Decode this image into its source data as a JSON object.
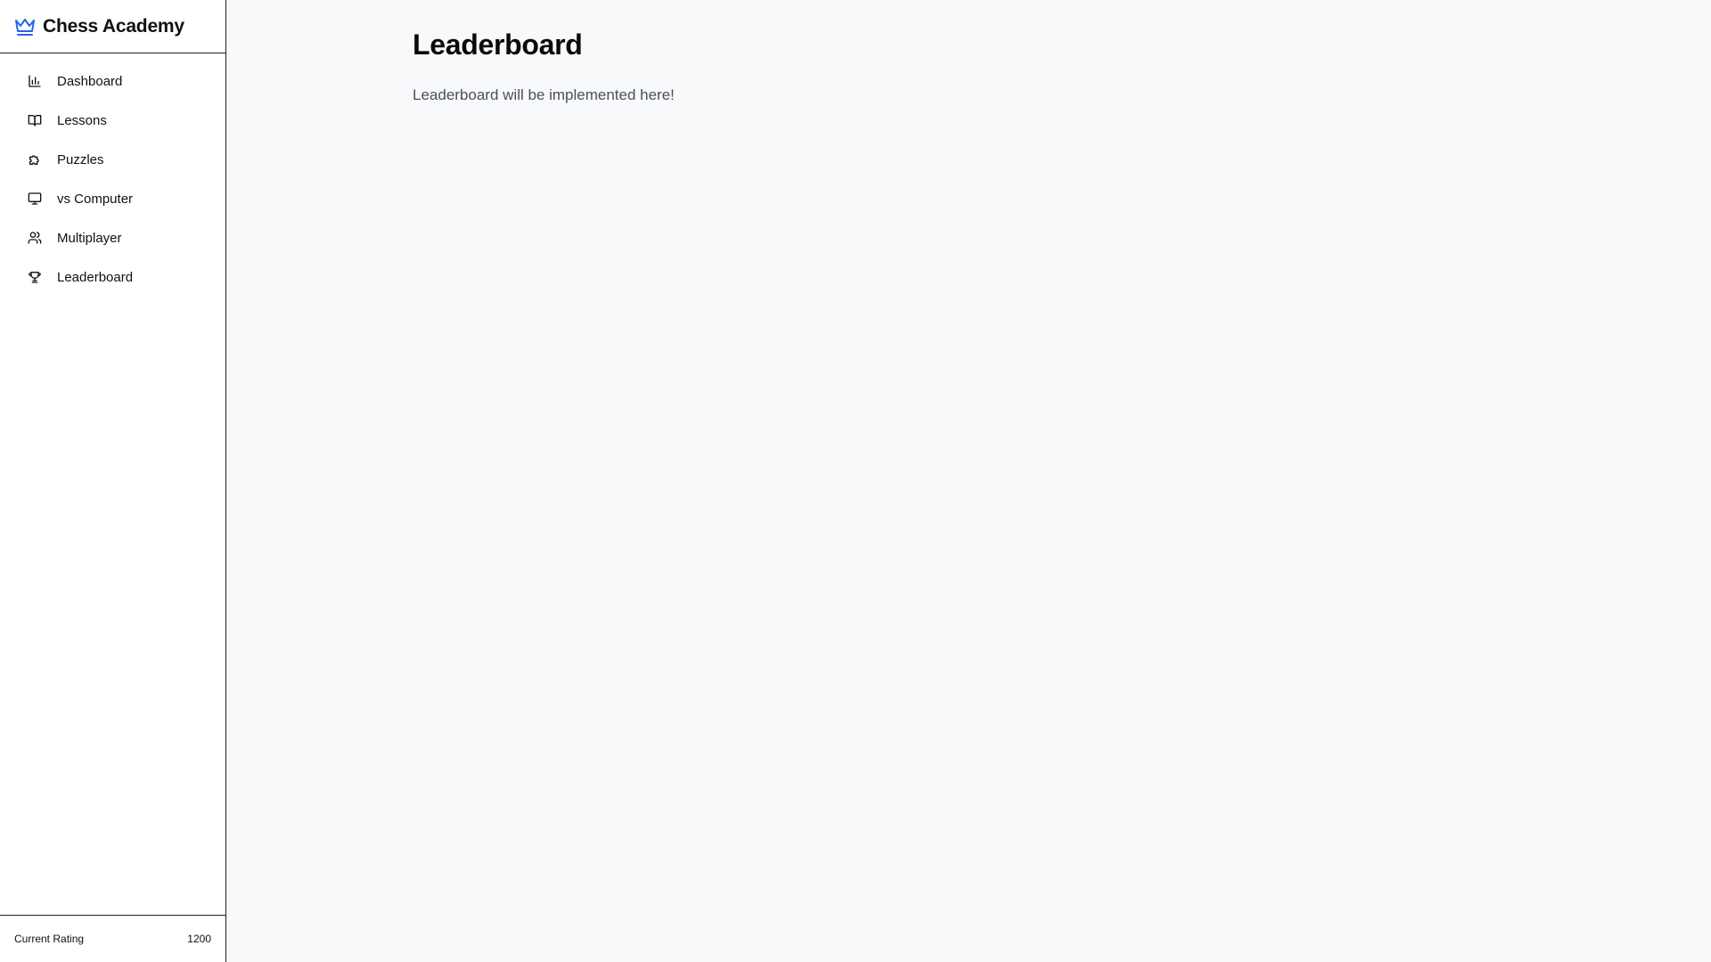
{
  "app": {
    "title": "Chess Academy"
  },
  "sidebar": {
    "items": [
      {
        "label": "Dashboard",
        "icon": "bar-chart-icon"
      },
      {
        "label": "Lessons",
        "icon": "book-icon"
      },
      {
        "label": "Puzzles",
        "icon": "puzzle-icon"
      },
      {
        "label": "vs Computer",
        "icon": "monitor-icon"
      },
      {
        "label": "Multiplayer",
        "icon": "users-icon"
      },
      {
        "label": "Leaderboard",
        "icon": "trophy-icon"
      }
    ],
    "rating_label": "Current Rating",
    "rating_value": "1200"
  },
  "main": {
    "title": "Leaderboard",
    "message": "Leaderboard will be implemented here!"
  },
  "colors": {
    "brand_accent": "#2563eb",
    "main_background": "#f8f9fb"
  }
}
